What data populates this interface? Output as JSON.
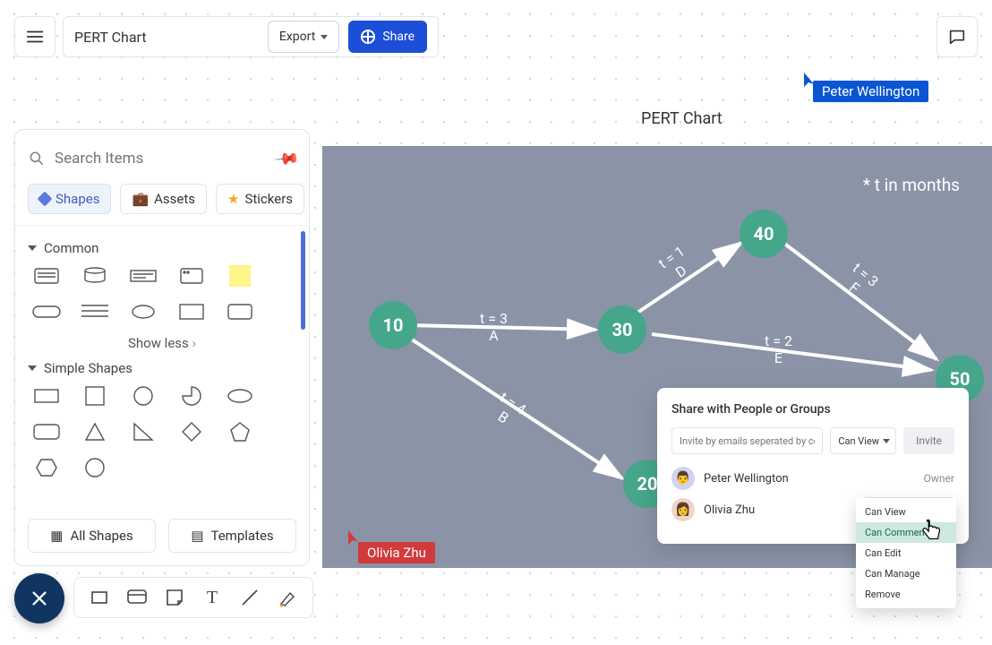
{
  "header": {
    "doc_title": "PERT Chart",
    "export_label": "Export",
    "share_label": "Share"
  },
  "cursors": {
    "peter": {
      "label": "Peter Wellington",
      "color": "#0b55d4"
    },
    "olivia": {
      "label": "Olivia Zhu",
      "color": "#d13b3b"
    }
  },
  "canvas": {
    "title": "PERT Chart",
    "note": "* t in months",
    "nodes": {
      "n10": "10",
      "n20": "20",
      "n30": "30",
      "n40": "40",
      "n50": "50"
    },
    "edges": {
      "A": "t = 3\nA",
      "B": "t = 4\nB",
      "D": "t = 1\nD",
      "E": "t = 2\nE",
      "F": "t = 3\nF"
    }
  },
  "sidebar": {
    "search_placeholder": "Search Items",
    "tabs": {
      "shapes": "Shapes",
      "assets": "Assets",
      "stickers": "Stickers"
    },
    "sections": {
      "common": "Common",
      "simple": "Simple Shapes"
    },
    "show_less": "Show less",
    "footer": {
      "all_shapes": "All Shapes",
      "templates": "Templates"
    }
  },
  "share_popover": {
    "title": "Share with People or Groups",
    "invite_placeholder": "Invite by emails seperated by comma",
    "default_perm": "Can View",
    "invite_label": "Invite",
    "people": [
      {
        "name": "Peter Wellington",
        "role": "Owner"
      },
      {
        "name": "Olivia Zhu",
        "perm": "Can Comment"
      }
    ],
    "menu": [
      "Can View",
      "Can Comment",
      "Can Edit",
      "Can Manage",
      "Remove"
    ],
    "menu_selected": "Can Comment"
  }
}
